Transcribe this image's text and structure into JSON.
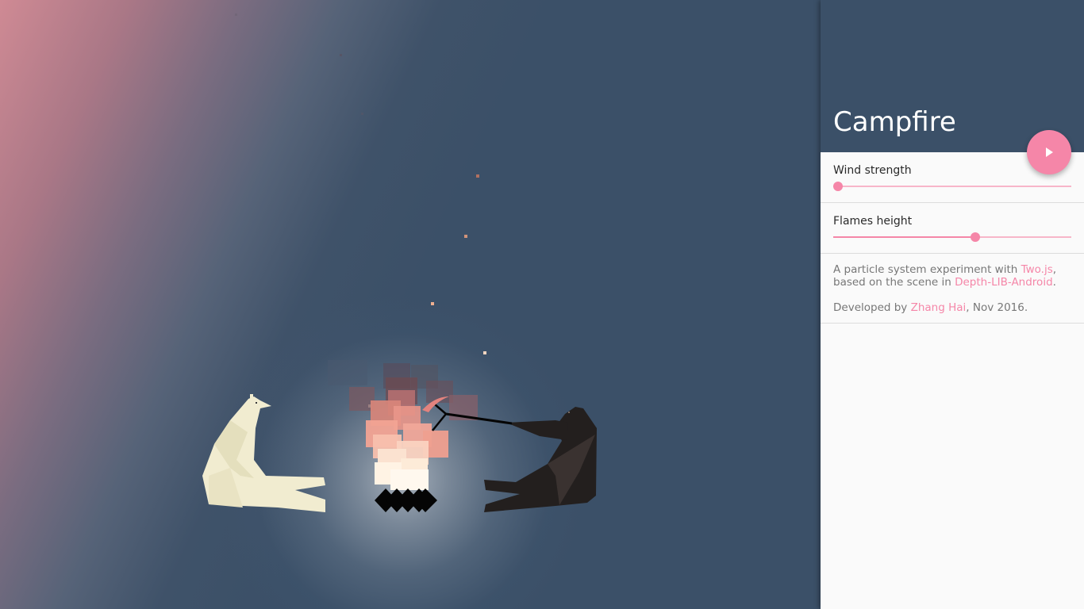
{
  "panel": {
    "title": "Campfire",
    "play_button": {
      "icon": "play-icon",
      "color": "#f586a8"
    },
    "controls": {
      "wind": {
        "label": "Wind strength",
        "value": 0.02
      },
      "flames": {
        "label": "Flames height",
        "value": 0.598
      }
    },
    "about": {
      "line1_prefix": "A particle system experiment with ",
      "line1_link": "Two.js",
      "line1_suffix": ",",
      "line2_prefix": "based on the scene in ",
      "line2_link": "Depth-LIB-Android",
      "line2_suffix": ".",
      "credit_prefix": "Developed by ",
      "credit_link": "Zhang Hai",
      "credit_suffix": ", Nov 2016."
    }
  },
  "colors": {
    "accent": "#f586a8",
    "header": "#3b5068",
    "background": "#3b5068",
    "white_bear": "#f1ecd0",
    "black_bear": "#231f1e"
  }
}
